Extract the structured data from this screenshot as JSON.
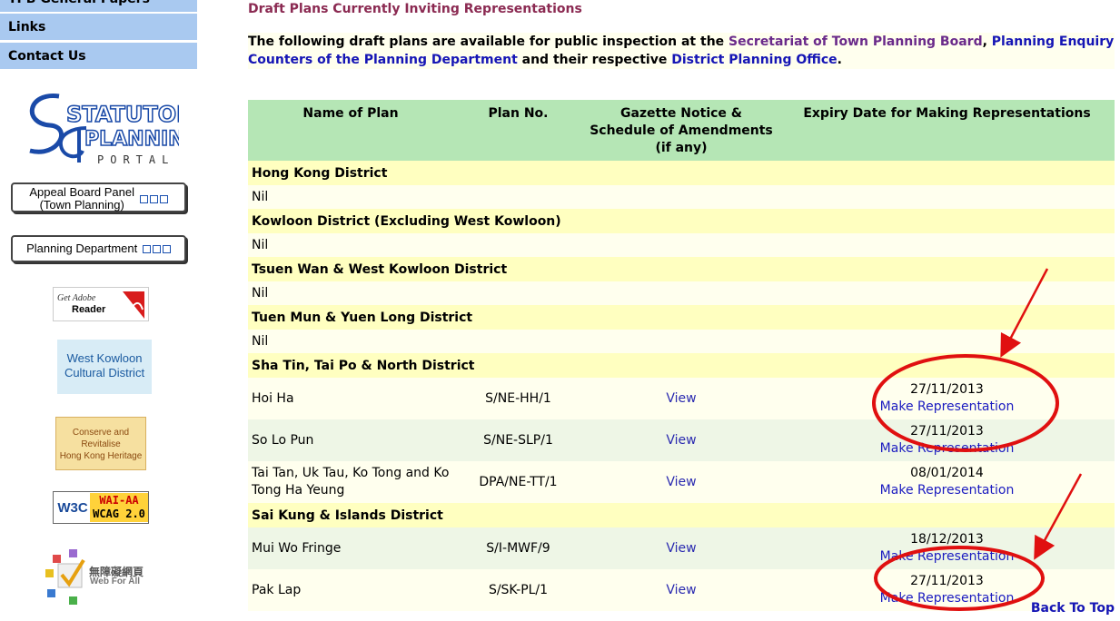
{
  "sidebar": {
    "items": [
      {
        "label": "TPB General Papers"
      },
      {
        "label": "Links"
      },
      {
        "label": "Contact Us"
      }
    ],
    "logo_text_top": "STATUTORY",
    "logo_text_mid": "PLANNING",
    "logo_text_sub": "PORTAL",
    "appeal_button": {
      "line1": "Appeal Board Panel",
      "line2": "(Town Planning)"
    },
    "planning_dept_button": {
      "label": "Planning Department"
    },
    "adobe": {
      "get": "Get Adobe",
      "reader": "Reader"
    },
    "wkcd": {
      "line1": "West Kowloon",
      "line2": "Cultural District"
    },
    "heritage": {
      "line1": "Conserve and",
      "line2": "Revitalise",
      "line3": "Hong Kong Heritage"
    },
    "w3c": {
      "logo": "W3C",
      "line1": "WAI-AA",
      "line2": "WCAG 2.0"
    },
    "web_for_all": {
      "chinese": "無障礙網頁",
      "english": "Web For All"
    }
  },
  "main": {
    "heading": "Draft Plans Currently Inviting Representations",
    "intro": {
      "part1": "The following draft plans are available for public inspection at the ",
      "link1": "Secretariat of Town Planning Board",
      "sep1": ", ",
      "link2": "Planning Enquiry Counters of the Planning Department",
      "part2": " and their respective ",
      "link3": "District Planning Office",
      "part3": "."
    },
    "table": {
      "headers": [
        "Name of Plan",
        "Plan No.",
        "Gazette Notice & Schedule of Amendments (if any)",
        "Expiry Date for Making Representations"
      ],
      "rows": [
        {
          "type": "district",
          "name": "Hong Kong District"
        },
        {
          "type": "nil",
          "name": "Nil"
        },
        {
          "type": "district",
          "name": "Kowloon District (Excluding West Kowloon)"
        },
        {
          "type": "nil",
          "name": "Nil"
        },
        {
          "type": "district",
          "name": "Tsuen Wan & West Kowloon District"
        },
        {
          "type": "nil",
          "name": "Nil"
        },
        {
          "type": "district",
          "name": "Tuen Mun & Yuen Long District"
        },
        {
          "type": "nil",
          "name": "Nil"
        },
        {
          "type": "district",
          "name": "Sha Tin, Tai Po & North District"
        },
        {
          "type": "plan",
          "name": "Hoi Ha",
          "code": "S/NE-HH/1",
          "gazette": "View",
          "expiry": "27/11/2013",
          "action": "Make Representation"
        },
        {
          "type": "plan",
          "name": "So Lo Pun",
          "code": "S/NE-SLP/1",
          "gazette": "View",
          "expiry": "27/11/2013",
          "action": "Make Representation"
        },
        {
          "type": "plan",
          "name": "Tai Tan, Uk Tau, Ko Tong and Ko Tong Ha Yeung",
          "code": "DPA/NE-TT/1",
          "gazette": "View",
          "expiry": "08/01/2014",
          "action": "Make Representation"
        },
        {
          "type": "district",
          "name": "Sai Kung & Islands District"
        },
        {
          "type": "plan",
          "name": "Mui Wo Fringe",
          "code": "S/I-MWF/9",
          "gazette": "View",
          "expiry": "18/12/2013",
          "action": "Make Representation"
        },
        {
          "type": "plan",
          "name": "Pak Lap",
          "code": "S/SK-PL/1",
          "gazette": "View",
          "expiry": "27/11/2013",
          "action": "Make Representation"
        }
      ]
    },
    "back_to_top": "Back To Top"
  },
  "colors": {
    "nav_bg": "#a9c9f0",
    "header_bg": "#b5e6b5",
    "district_bg": "#ffffc0",
    "heading": "#8b2a52",
    "link": "#1b1bc0",
    "annotation": "#e01010"
  }
}
